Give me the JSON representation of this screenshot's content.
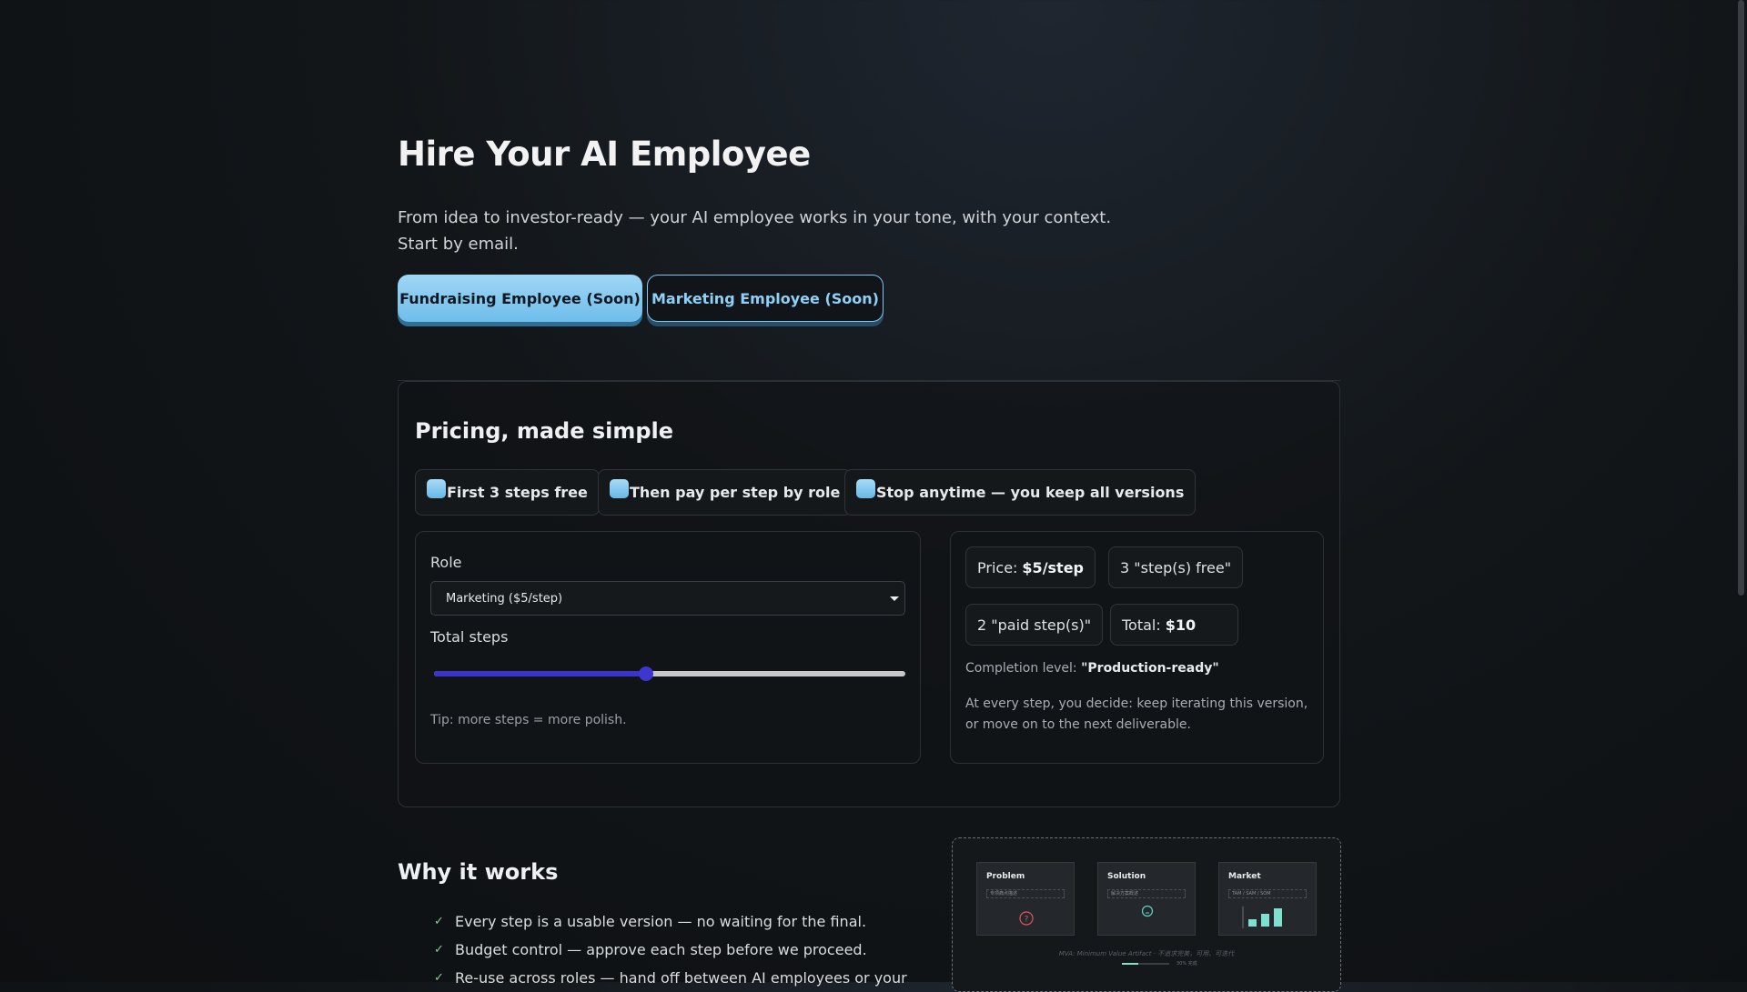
{
  "hero": {
    "title": "Hire Your AI Employee",
    "subtitle_line1": "From idea to investor-ready — your AI employee works in your tone, with your context.",
    "subtitle_line2": "Start by email.",
    "primary_button": "Fundraising Employee (Soon)",
    "secondary_button": "Marketing Employee (Soon)"
  },
  "pricing": {
    "title": "Pricing, made simple",
    "chips": [
      "First 3 steps free",
      "Then pay per step by role",
      "Stop anytime — you keep all versions"
    ],
    "role_label": "Role",
    "role_value": "Marketing ($5/step)",
    "steps_label": "Total steps",
    "steps_value_fraction": 0.45,
    "tip": "Tip: more steps = more polish.",
    "price_label": "Price:",
    "price_value": "$5/step",
    "free_steps": "3 \"step(s) free\"",
    "paid_steps": "2 \"paid step(s)\"",
    "total_label": "Total:",
    "total_value": "$10",
    "completion_label": "Completion level:",
    "completion_value": "\"Production-ready\"",
    "note": "At every step, you decide: keep iterating this version, or move on to the next deliverable."
  },
  "why": {
    "title": "Why it works",
    "items": [
      "Every step is a usable version — no waiting for the final.",
      "Budget control — approve each step before we proceed.",
      "Re-use across roles — hand off between AI employees or your"
    ]
  },
  "preview": {
    "cards": [
      {
        "title": "Problem",
        "input": "专项痛点描述"
      },
      {
        "title": "Solution",
        "input": "解决方案概述"
      },
      {
        "title": "Market",
        "input": "TAM / SAM / SOM"
      }
    ],
    "caption": "MVA: Minimum Value Artifact · 不追求完美，可用、可迭代",
    "progress_label": "30% 完成",
    "progress_fraction": 0.35
  },
  "colors": {
    "accent": "#7fc6ee",
    "slider": "#3a34c8",
    "check": "#7fd88f"
  }
}
